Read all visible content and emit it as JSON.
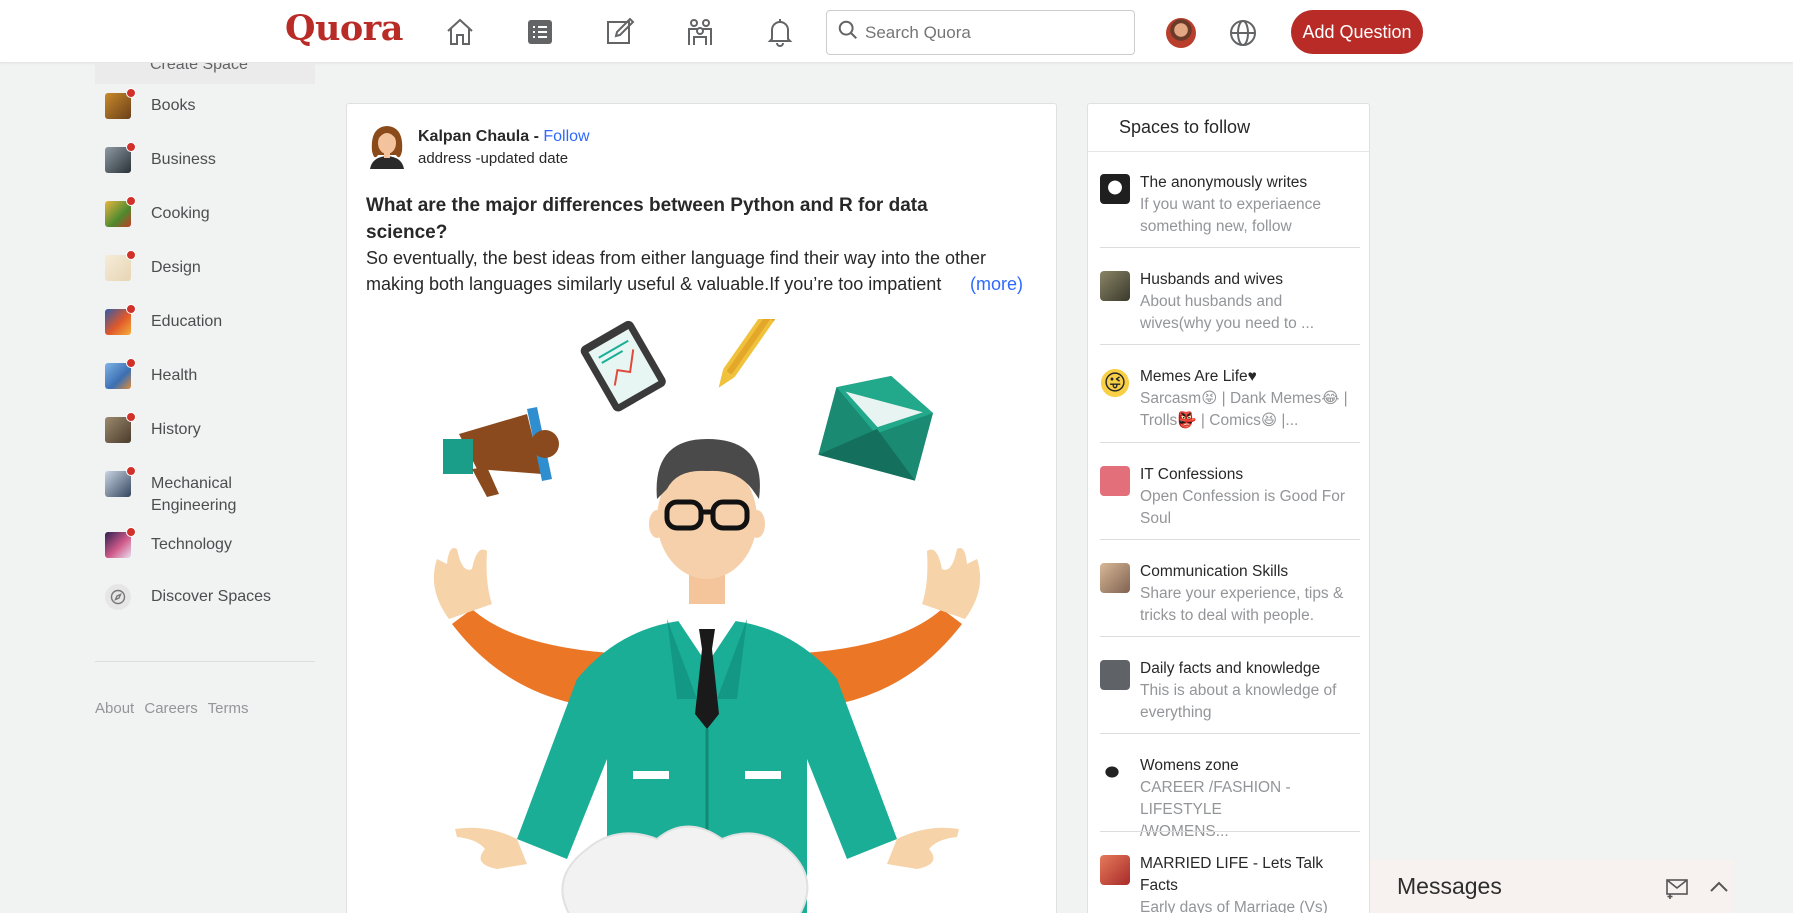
{
  "header": {
    "logo": "Quora",
    "search_placeholder": "Search Quora",
    "add_question": "Add Question",
    "icons": [
      "home-icon",
      "following-list-icon",
      "answer-edit-icon",
      "spaces-icon",
      "notifications-bell-icon",
      "globe-icon"
    ],
    "brand_color": "#b92b27"
  },
  "sidebar": {
    "partial_item": "Create Space",
    "items": [
      {
        "label": "Books",
        "thumb": "books",
        "color": "#c98a2a"
      },
      {
        "label": "Business",
        "thumb": "business",
        "color": "#3f4a53"
      },
      {
        "label": "Cooking",
        "thumb": "cooking",
        "color": "#d9872c"
      },
      {
        "label": "Design",
        "thumb": "design",
        "color": "#f0e3c8"
      },
      {
        "label": "Education",
        "thumb": "education",
        "color": "#d65a29"
      },
      {
        "label": "Health",
        "thumb": "health",
        "color": "#4a86c9"
      },
      {
        "label": "History",
        "thumb": "history",
        "color": "#6b5a44"
      },
      {
        "label": "Mechanical\nEngineering",
        "label_line1": "Mechanical",
        "label_line2": "Engineering",
        "thumb": "mech",
        "color": "#5a6f8c"
      },
      {
        "label": "Technology",
        "thumb": "technology",
        "color": "#8a5ea8"
      },
      {
        "label": "Discover Spaces",
        "thumb": "compass",
        "color": "#e4e4e4"
      }
    ],
    "footer": [
      "About",
      "Careers",
      "Terms"
    ]
  },
  "post": {
    "author": "Kalpan Chaula",
    "separator": " - ",
    "follow": "Follow",
    "subline": "address -updated date",
    "title": "What are the major differences between Python and R for data science?",
    "body_line1": "So eventually, the best ideas from either language find their way into the other",
    "body_line2": "making both languages similarly useful & valuable.If you’re too impatient",
    "more": "(more)"
  },
  "spaces": {
    "title": "Spaces to follow",
    "items": [
      {
        "name": "The anonymously writes",
        "desc1": "If you want to experiaence",
        "desc2": "something new, follow",
        "color": "#2b2b2b"
      },
      {
        "name": "Husbands and wives",
        "desc1": "About husbands and",
        "desc2": "wives(why you need to ...",
        "color": "#5d5a45"
      },
      {
        "name": "Memes Are Life♥",
        "desc1": "Sarcasm😝 | Dank Memes😂 |",
        "desc2": "Trolls👺 | Comics😆 |...",
        "color": "#f5c33b"
      },
      {
        "name": "IT Confessions",
        "desc1": "Open Confession is Good For",
        "desc2": "Soul",
        "color": "#e36f7a"
      },
      {
        "name": "Communication Skills",
        "desc1": "Share your experience, tips &",
        "desc2": "tricks to deal with people.",
        "color": "#b38b6d"
      },
      {
        "name": "Daily facts and knowledge",
        "desc1": "This is about a knowledge of",
        "desc2": "everything",
        "color": "#666a70"
      },
      {
        "name": "Womens zone",
        "desc1": "CAREER /FASHION -LIFESTYLE",
        "desc2": "/WOMENS...",
        "color": "#ffffff"
      },
      {
        "name": "MARRIED LIFE - Lets Talk",
        "name2": "Facts",
        "desc1": "Early days of Marriage (Vs)",
        "desc2": "",
        "color": "#d24a3f"
      }
    ]
  },
  "messages": {
    "title": "Messages",
    "icons": [
      "new-message-icon",
      "chevron-up-icon"
    ]
  }
}
